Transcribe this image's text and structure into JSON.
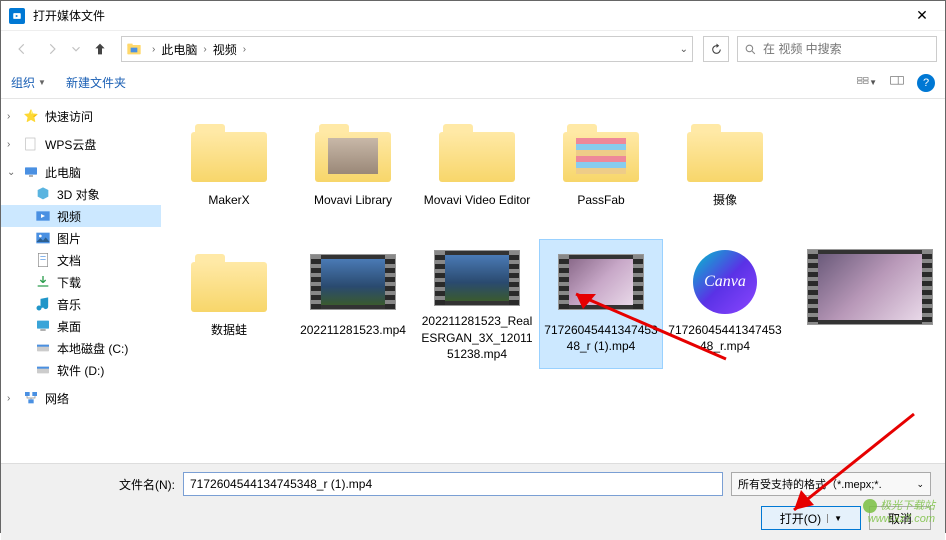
{
  "window": {
    "title": "打开媒体文件"
  },
  "breadcrumb": {
    "root": "此电脑",
    "folder": "视频"
  },
  "search": {
    "placeholder": "在 视频 中搜索"
  },
  "toolbar": {
    "organize": "组织",
    "newfolder": "新建文件夹"
  },
  "sidebar": {
    "quick": "快速访问",
    "wps": "WPS云盘",
    "thispc": "此电脑",
    "obj3d": "3D 对象",
    "video": "视频",
    "pictures": "图片",
    "documents": "文档",
    "downloads": "下载",
    "music": "音乐",
    "desktop": "桌面",
    "diskC": "本地磁盘 (C:)",
    "diskD": "软件 (D:)",
    "network": "网络"
  },
  "files": {
    "f0": "MakerX",
    "f1": "Movavi Library",
    "f2": "Movavi Video Editor",
    "f3": "PassFab",
    "f4": "摄像",
    "f5": "数据蛙",
    "f6": "202211281523.mp4",
    "f7": "202211281523_RealESRGAN_3X_1201151238.mp4",
    "f8": "7172604544134745348_r (1).mp4",
    "f9": "Canva",
    "f10": "7172604544134745348_r.mp4"
  },
  "footer": {
    "fnlabel": "文件名(N):",
    "fnvalue": "7172604544134745348_r (1).mp4",
    "filter": "所有受支持的格式（*.mepx;*.",
    "open": "打开(O)",
    "cancel": "取消"
  },
  "watermark": {
    "line1": "极光下载站",
    "line2": "www.xz7.com"
  }
}
